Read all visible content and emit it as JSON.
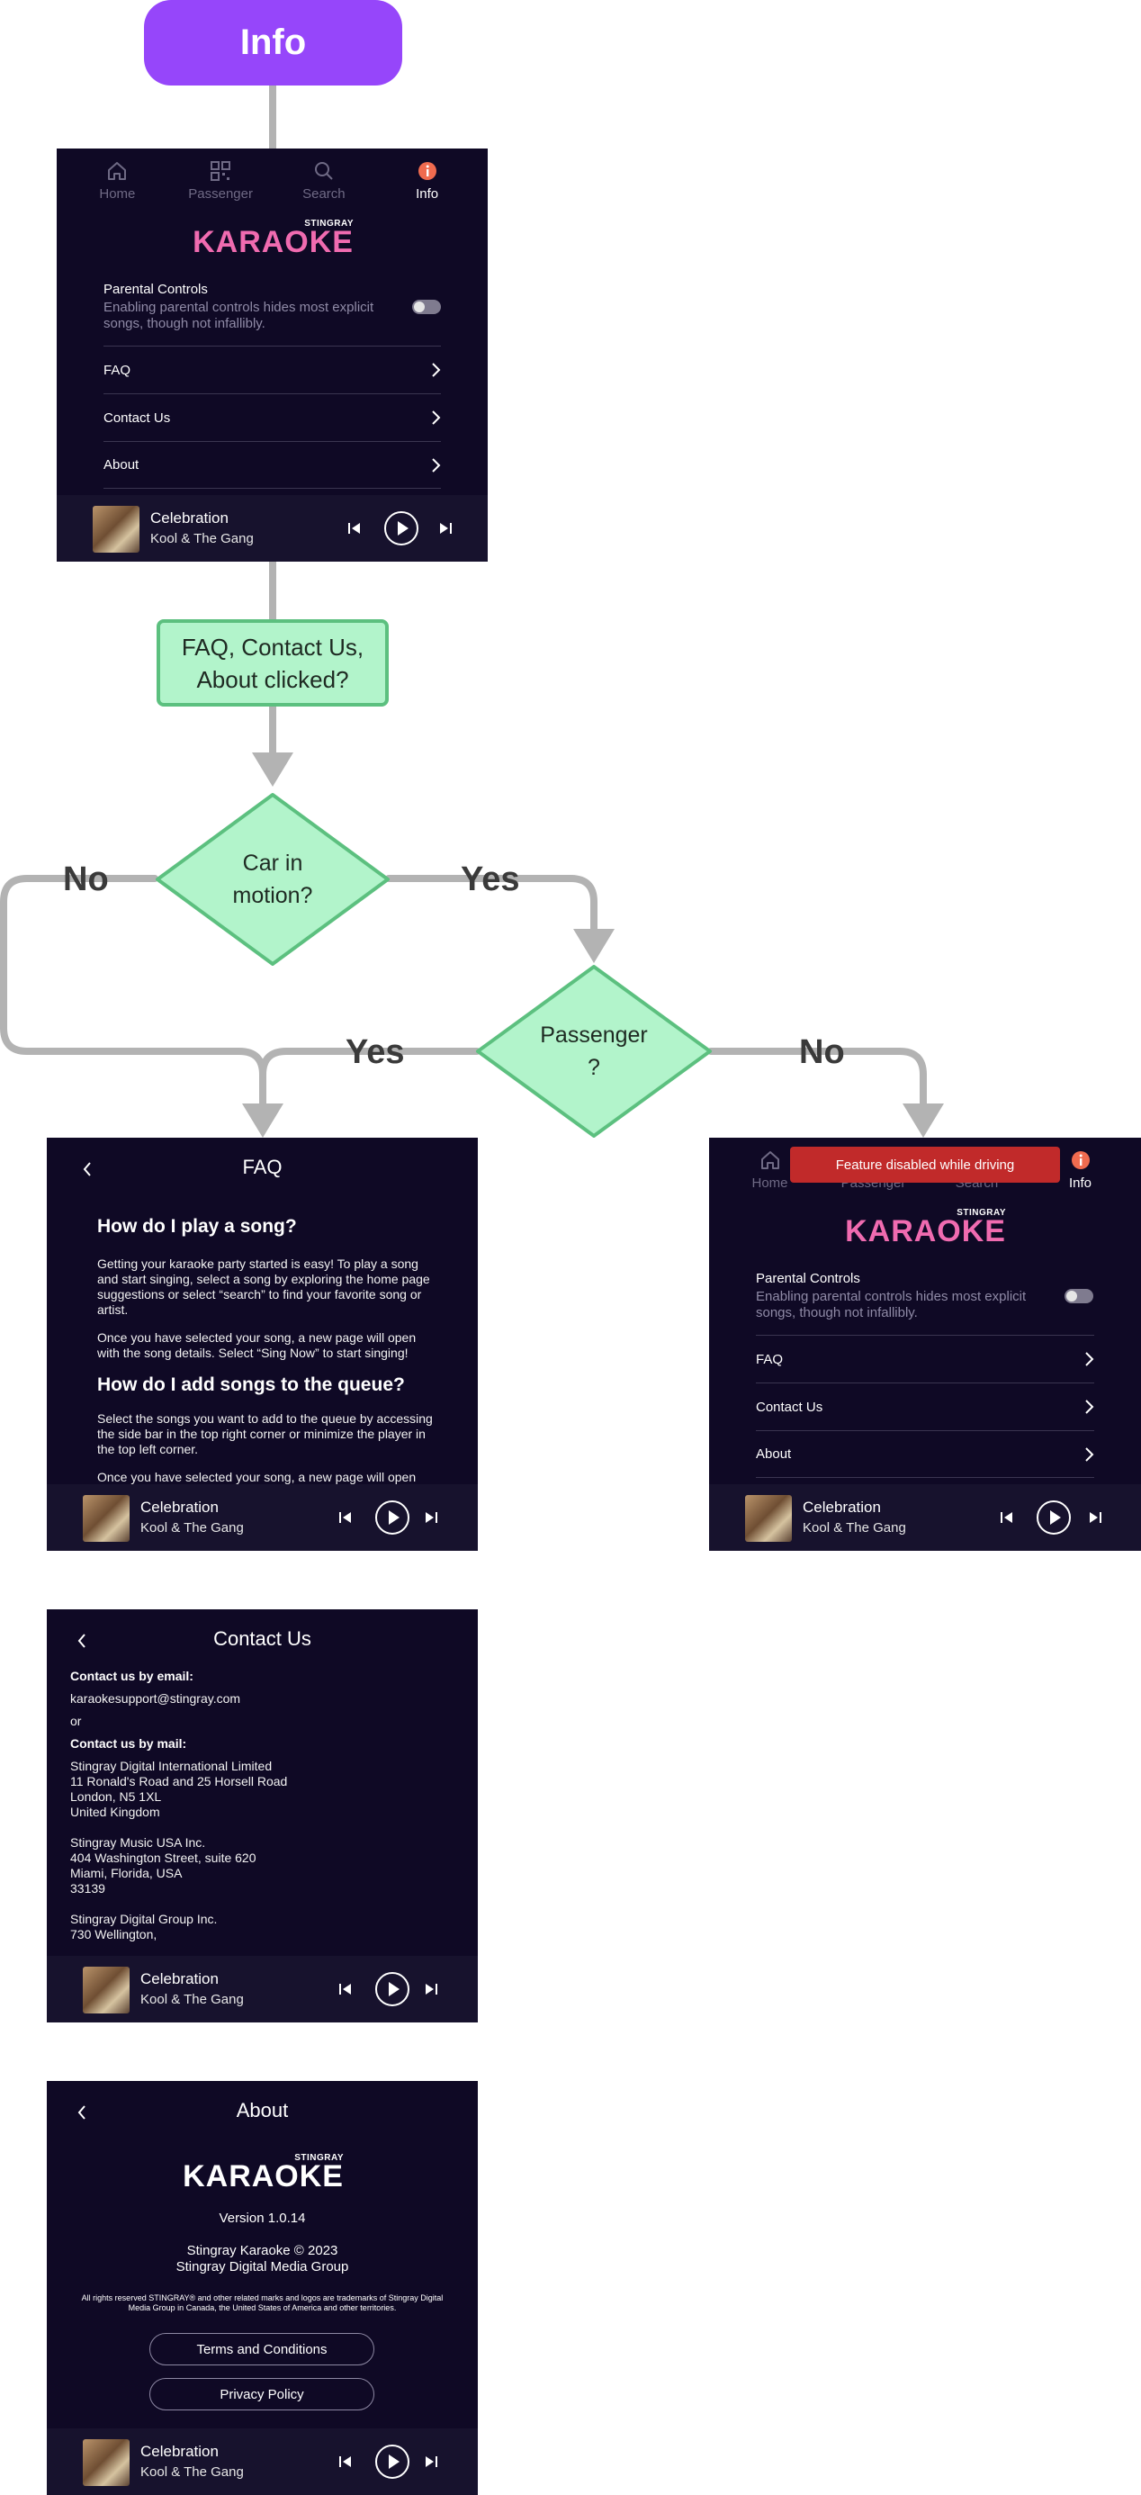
{
  "flow": {
    "start_label": "Info",
    "process_label": "FAQ, Contact Us, About clicked?",
    "decision_car": "Car in motion?",
    "decision_passenger": "Passenger ?",
    "edge_no_left": "No",
    "edge_yes_car": "Yes",
    "edge_yes_passenger": "Yes",
    "edge_no_passenger": "No"
  },
  "nav": {
    "home": "Home",
    "passenger": "Passenger",
    "search": "Search",
    "info": "Info"
  },
  "brand": {
    "small": "STINGRAY",
    "big": "KARAOKE"
  },
  "settings": {
    "parental_title": "Parental Controls",
    "parental_desc": "Enabling parental controls hides most explicit songs, though not infallibly.",
    "faq": "FAQ",
    "contact": "Contact Us",
    "about": "About"
  },
  "player": {
    "title": "Celebration",
    "artist": "Kool & The Gang"
  },
  "toast": "Feature disabled while driving",
  "faq": {
    "title": "FAQ",
    "q1": "How do I play a song?",
    "a1p1": "Getting your karaoke party started is easy! To play a song and start singing, select a song by exploring the home page suggestions or select “search” to find your favorite song or artist.",
    "a1p2": "Once you have selected your song, a new page will open with the song details. Select “Sing Now” to start singing!",
    "q2": "How do I add songs to the queue?",
    "a2p1": "Select the songs you want to add to the queue by accessing the side bar in the top right corner or minimize the player in the top left corner.",
    "a2p2": "Once you have selected your song, a new page will open"
  },
  "contact": {
    "title": "Contact Us",
    "email_label": "Contact us by email:",
    "email": "karaokesupport@stingray.com",
    "or": "or",
    "mail_label": "Contact us by mail:",
    "addr1": [
      "Stingray Digital International Limited",
      "11 Ronald's Road and 25 Horsell Road",
      "London, N5 1XL",
      "United Kingdom"
    ],
    "addr2": [
      "Stingray Music USA Inc.",
      "404 Washington Street, suite 620",
      "Miami, Florida, USA",
      "33139"
    ],
    "addr3": [
      "Stingray Digital Group Inc.",
      "730 Wellington,"
    ]
  },
  "about": {
    "title": "About",
    "version": "Version 1.0.14",
    "copyright": "Stingray Karaoke © 2023",
    "company": "Stingray Digital Media Group",
    "rights": "All rights reserved STINGRAY® and other related marks and logos are trademarks of Stingray Digital Media Group in Canada, the United States of America and other territories.",
    "terms": "Terms and Conditions",
    "privacy": "Privacy Policy"
  },
  "colors": {
    "start": "#9646fa",
    "decision_fill": "#b2f4cb",
    "decision_stroke": "#5cc07f",
    "connector": "#b3b3b3",
    "screen_bg": "#0f0925",
    "info_accent": "#f06b4f",
    "toast": "#c12a2a"
  }
}
